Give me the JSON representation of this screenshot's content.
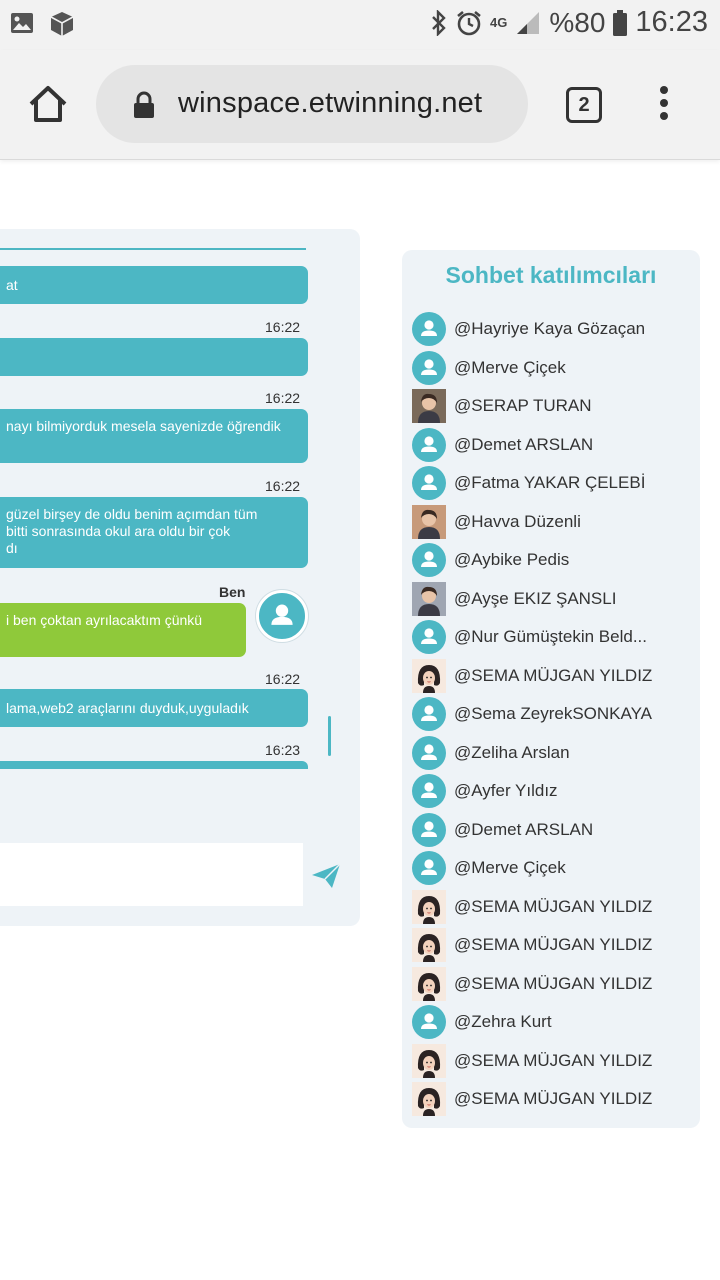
{
  "status_bar": {
    "network": "4G",
    "battery": "%80",
    "time": "16:23"
  },
  "browser": {
    "url": "winspace.etwinning.net",
    "tab_count": "2"
  },
  "chat": {
    "messages": [
      {
        "text": "at",
        "time": ""
      },
      {
        "text": "",
        "time": "16:22"
      },
      {
        "text": "nayı bilmiyorduk mesela sayenizde öğrendik",
        "time": "16:22"
      },
      {
        "text": "güzel birşey de oldu benim açımdan tüm\nbitti sonrasında okul ara oldu bir çok\ndı",
        "time": "16:22"
      },
      {
        "text": "i ben çoktan ayrılacaktım çünkü",
        "time": "",
        "sender": "Ben"
      },
      {
        "text": "lama,web2 araçlarını duyduk,uyguladık",
        "time": "16:22"
      },
      {
        "text": "",
        "time": "16:23"
      }
    ]
  },
  "participants": {
    "title": "Sohbet katılımcıları",
    "items": [
      {
        "name": "@Hayriye Kaya Gözaçan",
        "avatar": "default"
      },
      {
        "name": "@Merve Çiçek",
        "avatar": "default"
      },
      {
        "name": "@SERAP TURAN",
        "avatar": "photo"
      },
      {
        "name": "@Demet ARSLAN",
        "avatar": "default"
      },
      {
        "name": "@Fatma YAKAR ÇELEBİ",
        "avatar": "default"
      },
      {
        "name": "@Havva Düzenli",
        "avatar": "photo"
      },
      {
        "name": "@Aybike Pedis",
        "avatar": "default"
      },
      {
        "name": "@Ayşe EKIZ ŞANSLI",
        "avatar": "photo"
      },
      {
        "name": "@Nur Gümüştekin Beld...",
        "avatar": "default"
      },
      {
        "name": "@SEMA MÜJGAN YILDIZ",
        "avatar": "cartoon"
      },
      {
        "name": "@Sema ZeyrekSONKAYA",
        "avatar": "default"
      },
      {
        "name": "@Zeliha Arslan",
        "avatar": "default"
      },
      {
        "name": "@Ayfer Yıldız",
        "avatar": "default"
      },
      {
        "name": "@Demet ARSLAN",
        "avatar": "default"
      },
      {
        "name": "@Merve Çiçek",
        "avatar": "default"
      },
      {
        "name": "@SEMA MÜJGAN YILDIZ",
        "avatar": "cartoon"
      },
      {
        "name": "@SEMA MÜJGAN YILDIZ",
        "avatar": "cartoon"
      },
      {
        "name": "@SEMA MÜJGAN YILDIZ",
        "avatar": "cartoon"
      },
      {
        "name": "@Zehra Kurt",
        "avatar": "default"
      },
      {
        "name": "@SEMA MÜJGAN YILDIZ",
        "avatar": "cartoon"
      },
      {
        "name": "@SEMA MÜJGAN YILDIZ",
        "avatar": "cartoon"
      }
    ]
  },
  "colors": {
    "accent": "#4cb7c4",
    "own_message": "#8fc93a",
    "panel": "#eef3f7"
  }
}
